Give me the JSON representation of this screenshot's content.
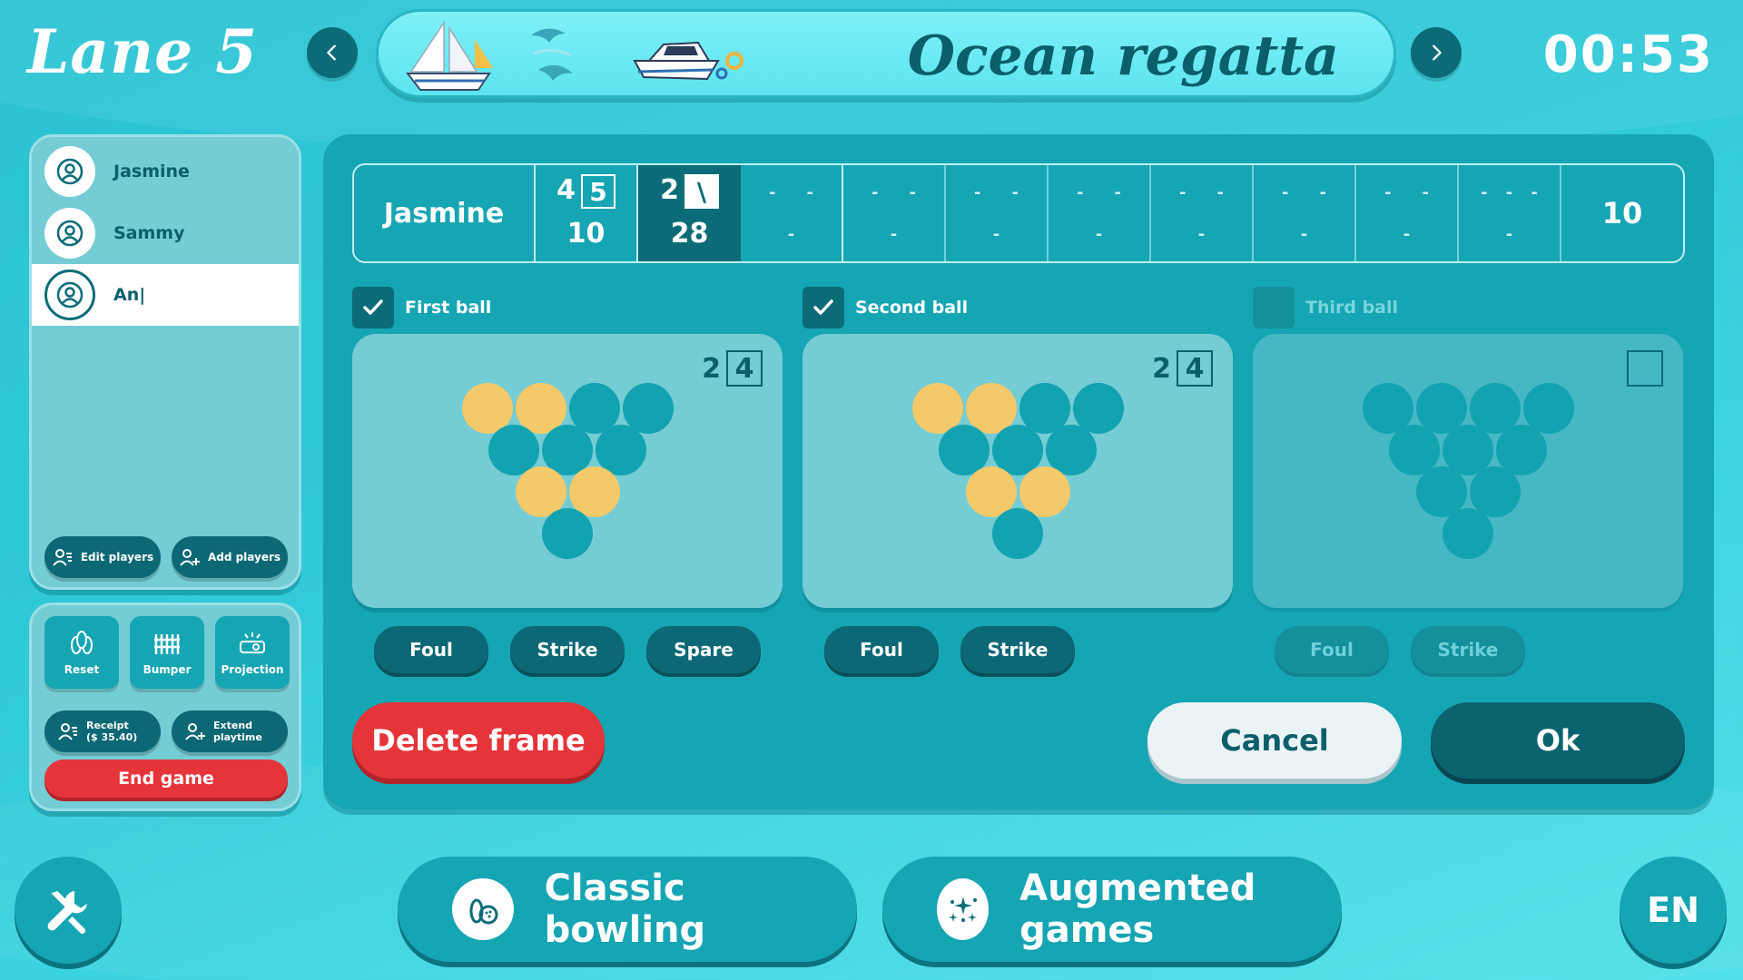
{
  "header": {
    "lane_title": "Lane 5",
    "theme_name": "Ocean regatta",
    "timer": "00:53"
  },
  "players": {
    "list": [
      {
        "name": "Jasmine"
      },
      {
        "name": "Sammy"
      },
      {
        "name": "An|"
      }
    ],
    "edit_label": "Edit players",
    "add_label": "Add players"
  },
  "tools": {
    "reset": "Reset",
    "bumper": "Bumper",
    "projection": "Projection",
    "receipt_line1": "Receipt",
    "receipt_line2": "($ 35.40)",
    "extend_line1": "Extend",
    "extend_line2": "playtime",
    "end_game": "End game"
  },
  "scorecard": {
    "player": "Jasmine",
    "frame1": {
      "roll1": "4",
      "roll2": "5",
      "total": "10"
    },
    "frame2": {
      "roll1": "2",
      "roll2": "\\",
      "total": "28"
    },
    "empty_mark": "-",
    "final_total": "10"
  },
  "balls": [
    {
      "label": "First ball",
      "checked": true,
      "count": "2",
      "count_box": "4",
      "pins_down": [
        1,
        2,
        8,
        9
      ]
    },
    {
      "label": "Second ball",
      "checked": true,
      "count": "2",
      "count_box": "4",
      "pins_down": [
        1,
        2,
        8,
        9
      ]
    },
    {
      "label": "Third ball",
      "checked": false,
      "count": "",
      "count_box": "",
      "pins_down": []
    }
  ],
  "actions": {
    "foul": "Foul",
    "strike": "Strike",
    "spare": "Spare",
    "delete_frame": "Delete frame",
    "cancel": "Cancel",
    "ok": "Ok"
  },
  "bottom": {
    "classic": "Classic bowling",
    "augmented": "Augmented games",
    "language": "EN"
  },
  "colors": {
    "accent_dark": "#0b6c78",
    "pin_down": "#f3c96a",
    "pin_up": "#13a2b0",
    "danger": "#e5353a"
  }
}
